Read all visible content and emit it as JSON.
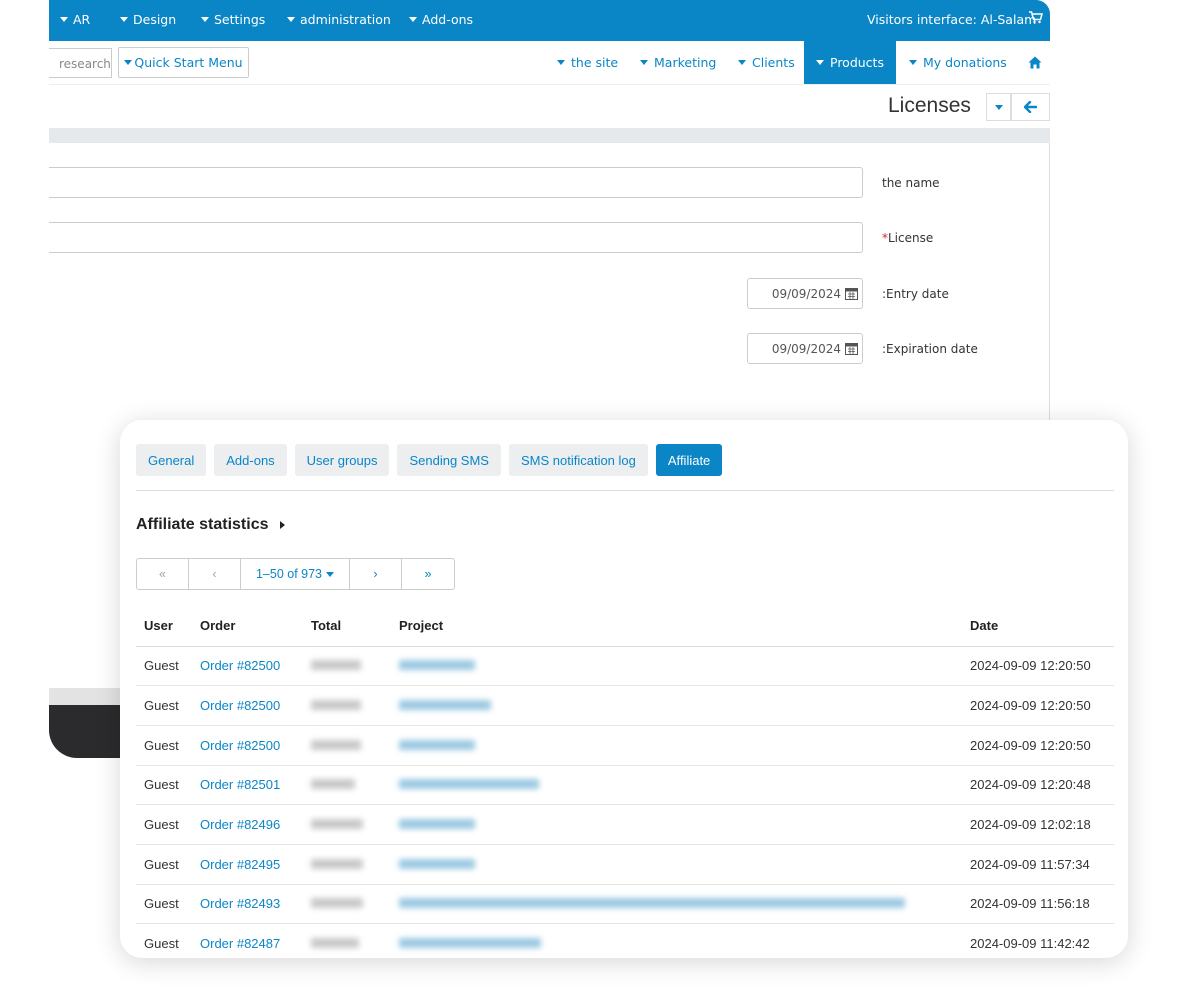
{
  "topbar": {
    "items": [
      "AR",
      "Design",
      "Settings",
      "administration",
      "Add-ons"
    ],
    "visitor_label": "Visitors interface: Al-Salam",
    "cart_icon": "cart-icon",
    "color": "#0a86c7"
  },
  "nav": {
    "search_placeholder": "research",
    "quick_start": "Quick Start Menu",
    "items": [
      "the site",
      "Marketing",
      "Clients",
      "Products",
      "My donations"
    ],
    "active": "Products",
    "home_icon": "home-icon"
  },
  "header": {
    "title": "Licenses"
  },
  "form": {
    "name_label": "the name",
    "license_label": "License",
    "license_required_mark": "*",
    "entry_date_label": ":Entry date",
    "entry_date_value": "09/09/2024",
    "expiration_date_label": ":Expiration date",
    "expiration_date_value": "09/09/2024"
  },
  "card": {
    "tabs": [
      "General",
      "Add-ons",
      "User groups",
      "Sending SMS",
      "SMS notification log",
      "Affiliate"
    ],
    "active_tab": "Affiliate",
    "section_title": "Affiliate statistics",
    "pager": {
      "first": "«",
      "prev": "‹",
      "range": "1–50 of 973",
      "next": "›",
      "last": "»"
    },
    "columns": [
      "User",
      "Order",
      "Total",
      "Project",
      "Date"
    ],
    "rows": [
      {
        "user": "Guest",
        "order": "Order #82500",
        "date": "2024-09-09 12:20:50"
      },
      {
        "user": "Guest",
        "order": "Order #82500",
        "date": "2024-09-09 12:20:50"
      },
      {
        "user": "Guest",
        "order": "Order #82500",
        "date": "2024-09-09 12:20:50"
      },
      {
        "user": "Guest",
        "order": "Order #82501",
        "date": "2024-09-09 12:20:48"
      },
      {
        "user": "Guest",
        "order": "Order #82496",
        "date": "2024-09-09 12:02:18"
      },
      {
        "user": "Guest",
        "order": "Order #82495",
        "date": "2024-09-09 11:57:34"
      },
      {
        "user": "Guest",
        "order": "Order #82493",
        "date": "2024-09-09 11:56:18"
      },
      {
        "user": "Guest",
        "order": "Order #82487",
        "date": "2024-09-09 11:42:42"
      }
    ]
  }
}
